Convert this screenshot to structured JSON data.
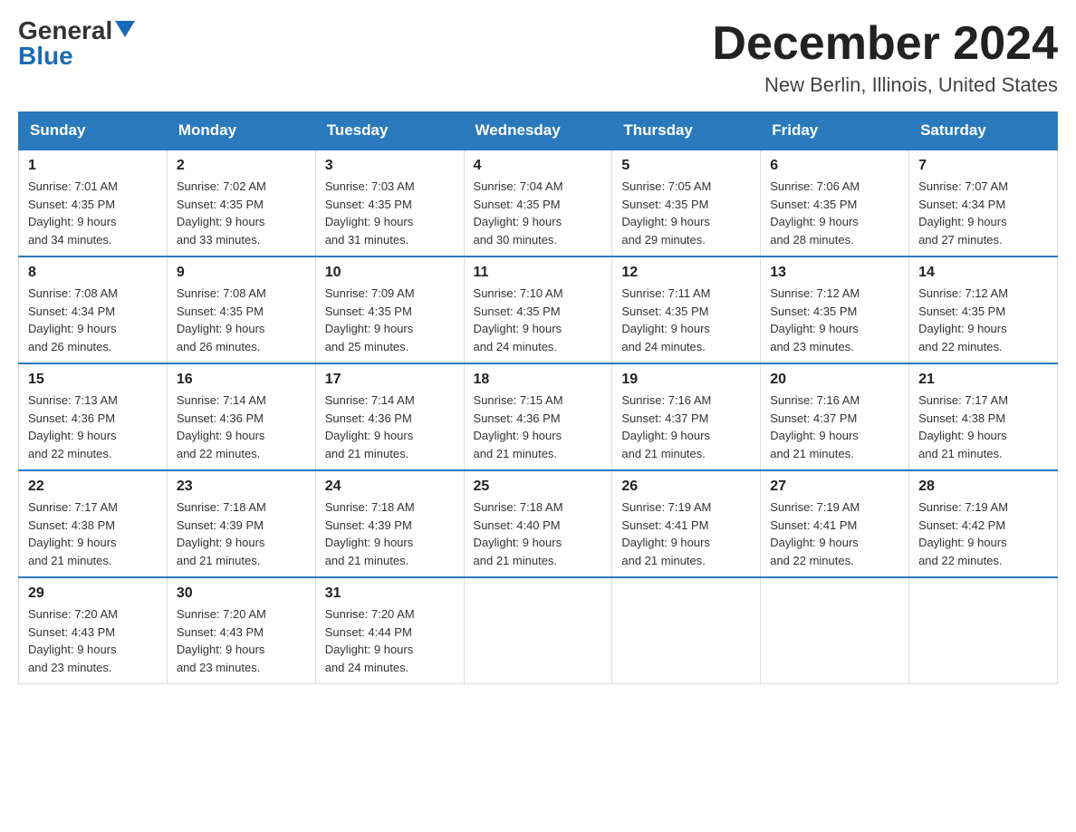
{
  "header": {
    "logo_general": "General",
    "logo_blue": "Blue",
    "title": "December 2024",
    "subtitle": "New Berlin, Illinois, United States"
  },
  "days_of_week": [
    "Sunday",
    "Monday",
    "Tuesday",
    "Wednesday",
    "Thursday",
    "Friday",
    "Saturday"
  ],
  "weeks": [
    [
      {
        "day": "1",
        "sunrise": "7:01 AM",
        "sunset": "4:35 PM",
        "daylight": "9 hours and 34 minutes."
      },
      {
        "day": "2",
        "sunrise": "7:02 AM",
        "sunset": "4:35 PM",
        "daylight": "9 hours and 33 minutes."
      },
      {
        "day": "3",
        "sunrise": "7:03 AM",
        "sunset": "4:35 PM",
        "daylight": "9 hours and 31 minutes."
      },
      {
        "day": "4",
        "sunrise": "7:04 AM",
        "sunset": "4:35 PM",
        "daylight": "9 hours and 30 minutes."
      },
      {
        "day": "5",
        "sunrise": "7:05 AM",
        "sunset": "4:35 PM",
        "daylight": "9 hours and 29 minutes."
      },
      {
        "day": "6",
        "sunrise": "7:06 AM",
        "sunset": "4:35 PM",
        "daylight": "9 hours and 28 minutes."
      },
      {
        "day": "7",
        "sunrise": "7:07 AM",
        "sunset": "4:34 PM",
        "daylight": "9 hours and 27 minutes."
      }
    ],
    [
      {
        "day": "8",
        "sunrise": "7:08 AM",
        "sunset": "4:34 PM",
        "daylight": "9 hours and 26 minutes."
      },
      {
        "day": "9",
        "sunrise": "7:08 AM",
        "sunset": "4:35 PM",
        "daylight": "9 hours and 26 minutes."
      },
      {
        "day": "10",
        "sunrise": "7:09 AM",
        "sunset": "4:35 PM",
        "daylight": "9 hours and 25 minutes."
      },
      {
        "day": "11",
        "sunrise": "7:10 AM",
        "sunset": "4:35 PM",
        "daylight": "9 hours and 24 minutes."
      },
      {
        "day": "12",
        "sunrise": "7:11 AM",
        "sunset": "4:35 PM",
        "daylight": "9 hours and 24 minutes."
      },
      {
        "day": "13",
        "sunrise": "7:12 AM",
        "sunset": "4:35 PM",
        "daylight": "9 hours and 23 minutes."
      },
      {
        "day": "14",
        "sunrise": "7:12 AM",
        "sunset": "4:35 PM",
        "daylight": "9 hours and 22 minutes."
      }
    ],
    [
      {
        "day": "15",
        "sunrise": "7:13 AM",
        "sunset": "4:36 PM",
        "daylight": "9 hours and 22 minutes."
      },
      {
        "day": "16",
        "sunrise": "7:14 AM",
        "sunset": "4:36 PM",
        "daylight": "9 hours and 22 minutes."
      },
      {
        "day": "17",
        "sunrise": "7:14 AM",
        "sunset": "4:36 PM",
        "daylight": "9 hours and 21 minutes."
      },
      {
        "day": "18",
        "sunrise": "7:15 AM",
        "sunset": "4:36 PM",
        "daylight": "9 hours and 21 minutes."
      },
      {
        "day": "19",
        "sunrise": "7:16 AM",
        "sunset": "4:37 PM",
        "daylight": "9 hours and 21 minutes."
      },
      {
        "day": "20",
        "sunrise": "7:16 AM",
        "sunset": "4:37 PM",
        "daylight": "9 hours and 21 minutes."
      },
      {
        "day": "21",
        "sunrise": "7:17 AM",
        "sunset": "4:38 PM",
        "daylight": "9 hours and 21 minutes."
      }
    ],
    [
      {
        "day": "22",
        "sunrise": "7:17 AM",
        "sunset": "4:38 PM",
        "daylight": "9 hours and 21 minutes."
      },
      {
        "day": "23",
        "sunrise": "7:18 AM",
        "sunset": "4:39 PM",
        "daylight": "9 hours and 21 minutes."
      },
      {
        "day": "24",
        "sunrise": "7:18 AM",
        "sunset": "4:39 PM",
        "daylight": "9 hours and 21 minutes."
      },
      {
        "day": "25",
        "sunrise": "7:18 AM",
        "sunset": "4:40 PM",
        "daylight": "9 hours and 21 minutes."
      },
      {
        "day": "26",
        "sunrise": "7:19 AM",
        "sunset": "4:41 PM",
        "daylight": "9 hours and 21 minutes."
      },
      {
        "day": "27",
        "sunrise": "7:19 AM",
        "sunset": "4:41 PM",
        "daylight": "9 hours and 22 minutes."
      },
      {
        "day": "28",
        "sunrise": "7:19 AM",
        "sunset": "4:42 PM",
        "daylight": "9 hours and 22 minutes."
      }
    ],
    [
      {
        "day": "29",
        "sunrise": "7:20 AM",
        "sunset": "4:43 PM",
        "daylight": "9 hours and 23 minutes."
      },
      {
        "day": "30",
        "sunrise": "7:20 AM",
        "sunset": "4:43 PM",
        "daylight": "9 hours and 23 minutes."
      },
      {
        "day": "31",
        "sunrise": "7:20 AM",
        "sunset": "4:44 PM",
        "daylight": "9 hours and 24 minutes."
      },
      null,
      null,
      null,
      null
    ]
  ],
  "labels": {
    "sunrise": "Sunrise:",
    "sunset": "Sunset:",
    "daylight": "Daylight:"
  }
}
